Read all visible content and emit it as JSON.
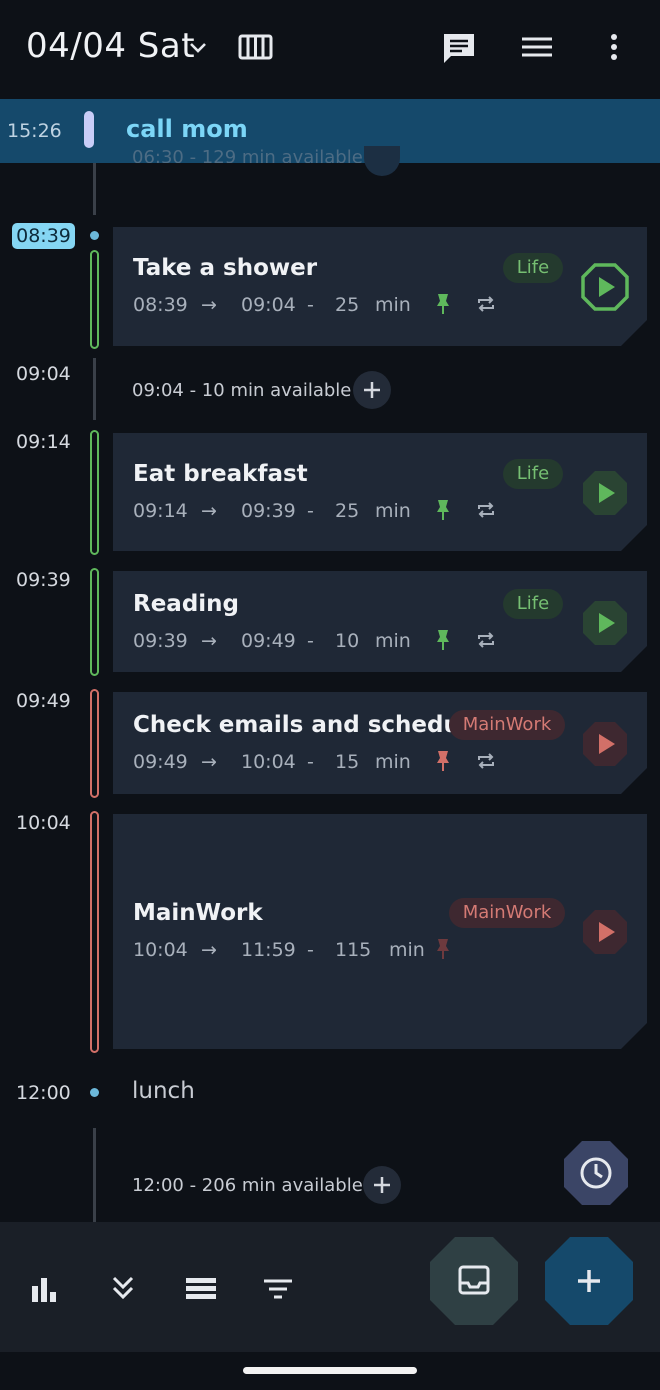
{
  "header": {
    "date": "04/04 Sat",
    "icons": [
      "chevron-down-icon",
      "calendar-grid-icon",
      "chat-icon",
      "menu-lines-icon",
      "more-vert-icon"
    ]
  },
  "current": {
    "time": "15:26",
    "title": "call mom",
    "ghost_text": "06:30 - 129 min available"
  },
  "timeline": {
    "now_badge": "08:39",
    "labels": [
      "09:04",
      "09:14",
      "09:39",
      "09:49",
      "10:04",
      "12:00"
    ]
  },
  "tasks": [
    {
      "title": "Take a shower",
      "start": "08:39",
      "end": "09:04",
      "dash": "-",
      "duration": "25",
      "unit": "min",
      "tag": "Life",
      "arrow": "→"
    },
    {
      "title": "Eat breakfast",
      "start": "09:14",
      "end": "09:39",
      "dash": "-",
      "duration": "25",
      "unit": "min",
      "tag": "Life",
      "arrow": "→"
    },
    {
      "title": "Reading",
      "start": "09:39",
      "end": "09:49",
      "dash": "-",
      "duration": "10",
      "unit": "min",
      "tag": "Life",
      "arrow": "→"
    },
    {
      "title": "Check emails and schedule",
      "start": "09:49",
      "end": "10:04",
      "dash": "-",
      "duration": "15",
      "unit": "min",
      "tag": "MainWork",
      "arrow": "→"
    },
    {
      "title": "MainWork",
      "start": "10:04",
      "end": "11:59",
      "dash": "-",
      "duration": "115",
      "unit": "min",
      "tag": "MainWork",
      "arrow": "→"
    }
  ],
  "gaps": [
    {
      "text": "09:04 - 10 min available"
    },
    {
      "text": "12:00 - 206 min available"
    }
  ],
  "lunch": "lunch",
  "colors": {
    "life": "#5fb85c",
    "work": "#d27068",
    "accent": "#85d6f3",
    "banner": "#15496b",
    "card": "#1f2836"
  },
  "bottom": {
    "icons": [
      "bar-chart-icon",
      "double-chevron-down-icon",
      "list-view-icon",
      "filter-icon",
      "inbox-icon",
      "add-icon"
    ]
  }
}
